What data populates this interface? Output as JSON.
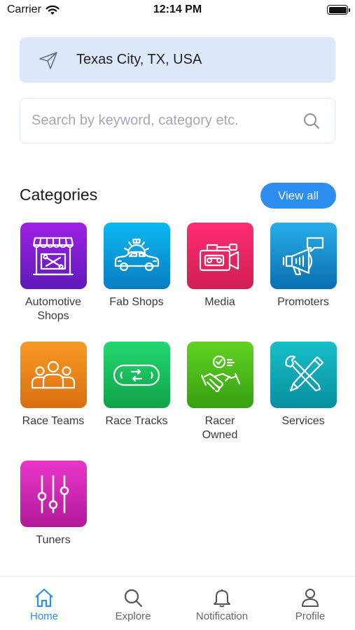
{
  "status_bar": {
    "carrier": "Carrier",
    "time": "12:14 PM"
  },
  "location": {
    "text": "Texas City, TX, USA",
    "icon": "paper-plane-icon"
  },
  "search": {
    "placeholder": "Search by keyword, category etc.",
    "value": "",
    "icon": "search-icon"
  },
  "categories": {
    "title": "Categories",
    "view_all_label": "View all",
    "items": [
      {
        "label": "Automotive Shops",
        "icon": "storefront-wrench-icon",
        "gradient": [
          "#a020e6",
          "#5e1ab8"
        ]
      },
      {
        "label": "Fab Shops",
        "icon": "car-gear-icon",
        "gradient": [
          "#0bb8f0",
          "#0a7cc2"
        ]
      },
      {
        "label": "Media",
        "icon": "video-camera-icon",
        "gradient": [
          "#ff2d73",
          "#cf1f52"
        ]
      },
      {
        "label": "Promoters",
        "icon": "megaphone-icon",
        "gradient": [
          "#27aee8",
          "#0b6fb0"
        ]
      },
      {
        "label": "Race Teams",
        "icon": "team-icon",
        "gradient": [
          "#f79a24",
          "#d96f10"
        ]
      },
      {
        "label": "Race Tracks",
        "icon": "race-track-icon",
        "gradient": [
          "#22d870",
          "#10a24a"
        ]
      },
      {
        "label": "Racer Owned",
        "icon": "handshake-icon",
        "gradient": [
          "#62d222",
          "#36a012"
        ]
      },
      {
        "label": "Services",
        "icon": "tools-icon",
        "gradient": [
          "#16bfc8",
          "#0a8f9e"
        ]
      },
      {
        "label": "Tuners",
        "icon": "sliders-icon",
        "gradient": [
          "#ea36c8",
          "#b01a9a"
        ]
      }
    ]
  },
  "bottom_nav": {
    "items": [
      {
        "label": "Home",
        "icon": "home-icon",
        "active": true
      },
      {
        "label": "Explore",
        "icon": "search-icon",
        "active": false
      },
      {
        "label": "Notification",
        "icon": "bell-icon",
        "active": false
      },
      {
        "label": "Profile",
        "icon": "person-icon",
        "active": false
      }
    ]
  },
  "colors": {
    "accent": "#2d8ef0",
    "location_bg": "#dde9fb",
    "nav_inactive": "#666666"
  }
}
